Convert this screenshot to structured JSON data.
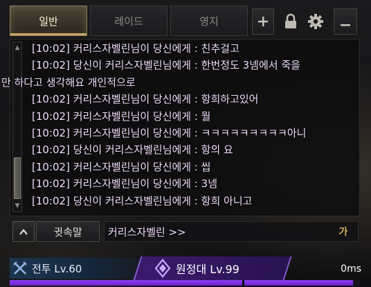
{
  "tabs": [
    {
      "label": "일반",
      "active": true
    },
    {
      "label": "레이드",
      "active": false
    },
    {
      "label": "영지",
      "active": false
    }
  ],
  "toolbar": {
    "add_icon": "plus-icon",
    "lock_icon": "lock-icon",
    "settings_icon": "gear-icon",
    "minimize_icon": "minimize-icon"
  },
  "messages": [
    {
      "time": "[10:02]",
      "text": "커리스자벨린님이 당신에게 : 친추걸고"
    },
    {
      "time": "[10:02]",
      "text": "당신이 커리스자벨린님에게 : 한번정도 3넴에서 죽을",
      "cont": "만 하다고 생각해요 개인적으로"
    },
    {
      "time": "[10:02]",
      "text": "커리스자벨린님이 당신에게 : 항희하고있어"
    },
    {
      "time": "[10:02]",
      "text": "커리스자벨린님이 당신에게 : 뭘"
    },
    {
      "time": "[10:02]",
      "text": "커리스자벨린님이 당신에게 : ㅋㅋㅋㅋㅋㅋㅋㅋㅋ아니"
    },
    {
      "time": "[10:02]",
      "text": "당신이 커리스자벨린님에게 : 항의 요"
    },
    {
      "time": "[10:02]",
      "text": "커리스자벨린님이 당신에게 : 씹"
    },
    {
      "time": "[10:02]",
      "text": "커리스자벨린님이 당신에게 : 3넴"
    },
    {
      "time": "[10:02]",
      "text": "당신이 커리스자벨린님에게 : 항희 아니고"
    }
  ],
  "input": {
    "channel_label": "귓속말",
    "target": "커리스자벨린 >>",
    "ime_mode": "가"
  },
  "bottom": {
    "combat_label": "전투 Lv.60",
    "expedition_label": "원정대 Lv.99",
    "ping": "0ms",
    "xp_progress": 0.98
  },
  "colors": {
    "whisper_text": "#f3e0ff",
    "active_tab_accent": "#c9a86a",
    "expedition_purple": "#3a1a6e",
    "xp_fill": "#8d3cf0"
  }
}
